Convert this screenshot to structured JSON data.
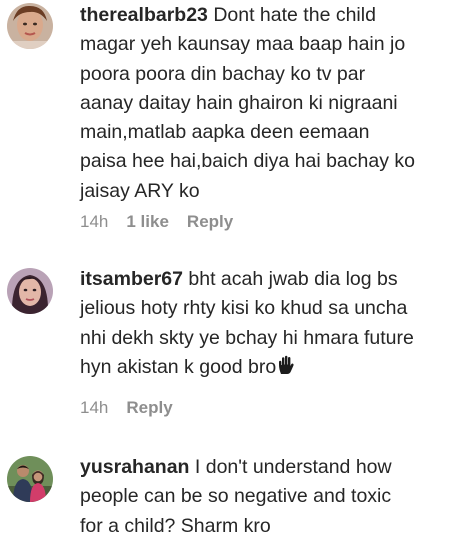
{
  "comments": [
    {
      "username": "therealbarb23",
      "text": "Dont hate the child\nmagar yeh kaunsay maa baap hain jo\npoora poora din bachay ko tv par\naanay daitay hain ghairon ki nigraani\nmain,matlab aapka deen eemaan\npaisa hee hai,baich diya hai bachay ko\njaisay ARY ko",
      "time": "14h",
      "likes": "1 like",
      "reply": "Reply"
    },
    {
      "username": "itsamber67",
      "text": "bht acah jwab dia log bs\njelious hoty rhty kisi ko khud sa uncha\nnhi dekh skty ye bchay hi hmara future\nhyn akistan k good bro",
      "emoji_icon": "raised-hand-icon",
      "time": "14h",
      "reply": "Reply"
    },
    {
      "username": "yusrahanan",
      "text": "I don't understand how\npeople can be so negative and toxic\nfor a child? Sharm kro"
    }
  ],
  "colors": {
    "text": "#262626",
    "meta": "#8e8e8e",
    "background": "#ffffff"
  }
}
